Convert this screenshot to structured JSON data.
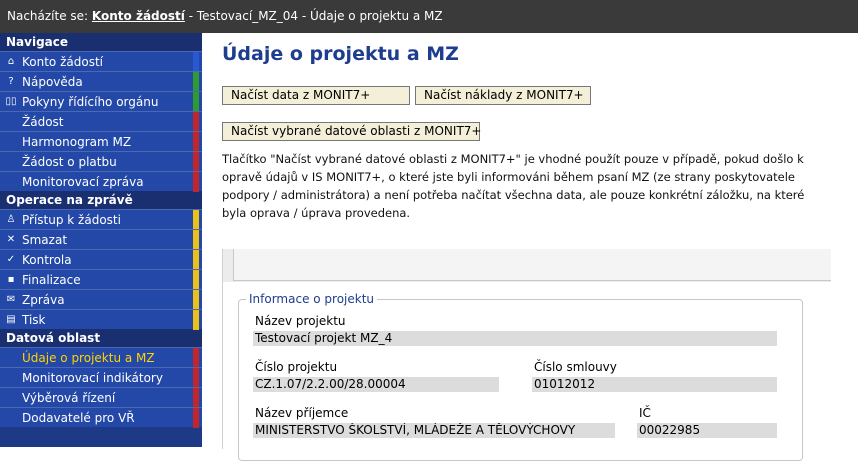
{
  "topbar": {
    "prefix": "Nacházíte se: ",
    "link": "Konto žádostí",
    "trail": " - Testovací_MZ_04 - Údaje o projektu a MZ"
  },
  "sidebar": {
    "sections": [
      {
        "title": "Navigace",
        "items": [
          {
            "label": "Konto žádostí",
            "icon": "⌂",
            "strip": "#2b57d1"
          },
          {
            "label": "Nápověda",
            "icon": "?",
            "strip": "#2e9a30"
          },
          {
            "label": "Pokyny řídícího orgánu",
            "icon": "▯▯",
            "strip": "#2e9a30"
          },
          {
            "label": "Žádost",
            "icon": "",
            "strip": "#c0262b"
          },
          {
            "label": "Harmonogram MZ",
            "icon": "",
            "strip": "#c0262b"
          },
          {
            "label": "Žádost o platbu",
            "icon": "",
            "strip": "#c0262b"
          },
          {
            "label": "Monitorovací zpráva",
            "icon": "",
            "strip": "#c0262b"
          }
        ]
      },
      {
        "title": "Operace na zprávě",
        "items": [
          {
            "label": "Přístup k žádosti",
            "icon": "♙",
            "strip": "#e8c21b"
          },
          {
            "label": "Smazat",
            "icon": "✕",
            "strip": "#e8c21b"
          },
          {
            "label": "Kontrola",
            "icon": "✓",
            "strip": "#e8c21b"
          },
          {
            "label": "Finalizace",
            "icon": "▪",
            "strip": "#e8c21b"
          },
          {
            "label": "Zpráva",
            "icon": "✉",
            "strip": "#e8c21b"
          },
          {
            "label": "Tisk",
            "icon": "▤",
            "strip": "#e8c21b"
          }
        ]
      },
      {
        "title": "Datová oblast",
        "items": [
          {
            "label": "Údaje o projektu a MZ",
            "icon": "",
            "strip": "#c0262b",
            "active": true
          },
          {
            "label": "Monitorovací indikátory",
            "icon": "",
            "strip": "#c0262b"
          },
          {
            "label": "Výběrová řízení",
            "icon": "",
            "strip": "#c0262b"
          },
          {
            "label": "Dodavatelé pro VŘ",
            "icon": "",
            "strip": "#c0262b"
          }
        ]
      }
    ]
  },
  "main": {
    "title": "Údaje o projektu a MZ",
    "buttons": {
      "load_data": "Načíst data z MONIT7+",
      "load_costs": "Načíst náklady z MONIT7+",
      "load_selected": "Načíst vybrané datové oblasti z MONIT7+"
    },
    "description": "Tlačítko \"Načíst vybrané datové oblasti z MONIT7+\" je vhodné použít pouze v případě, pokud došlo k opravě údajů v IS MONIT7+, o které jste byli informováni během psaní MZ (ze strany poskytovatele podpory / administrátora) a není potřeba načítat všechna data, ale pouze konkrétní záložku, na které byla oprava / úprava provedena.",
    "project_info": {
      "legend": "Informace o projektu",
      "name_label": "Název projektu",
      "name_value": "Testovací projekt MZ_4",
      "number_label": "Číslo projektu",
      "number_value": "CZ.1.07/2.2.00/28.00004",
      "contract_label": "Číslo smlouvy",
      "contract_value": "01012012",
      "recipient_label": "Název příjemce",
      "recipient_value": "MINISTERSTVO ŠKOLSTVÍ, MLÁDEŽE A TĚLOVÝCHOVY",
      "ic_label": "IČ",
      "ic_value": "00022985"
    }
  }
}
